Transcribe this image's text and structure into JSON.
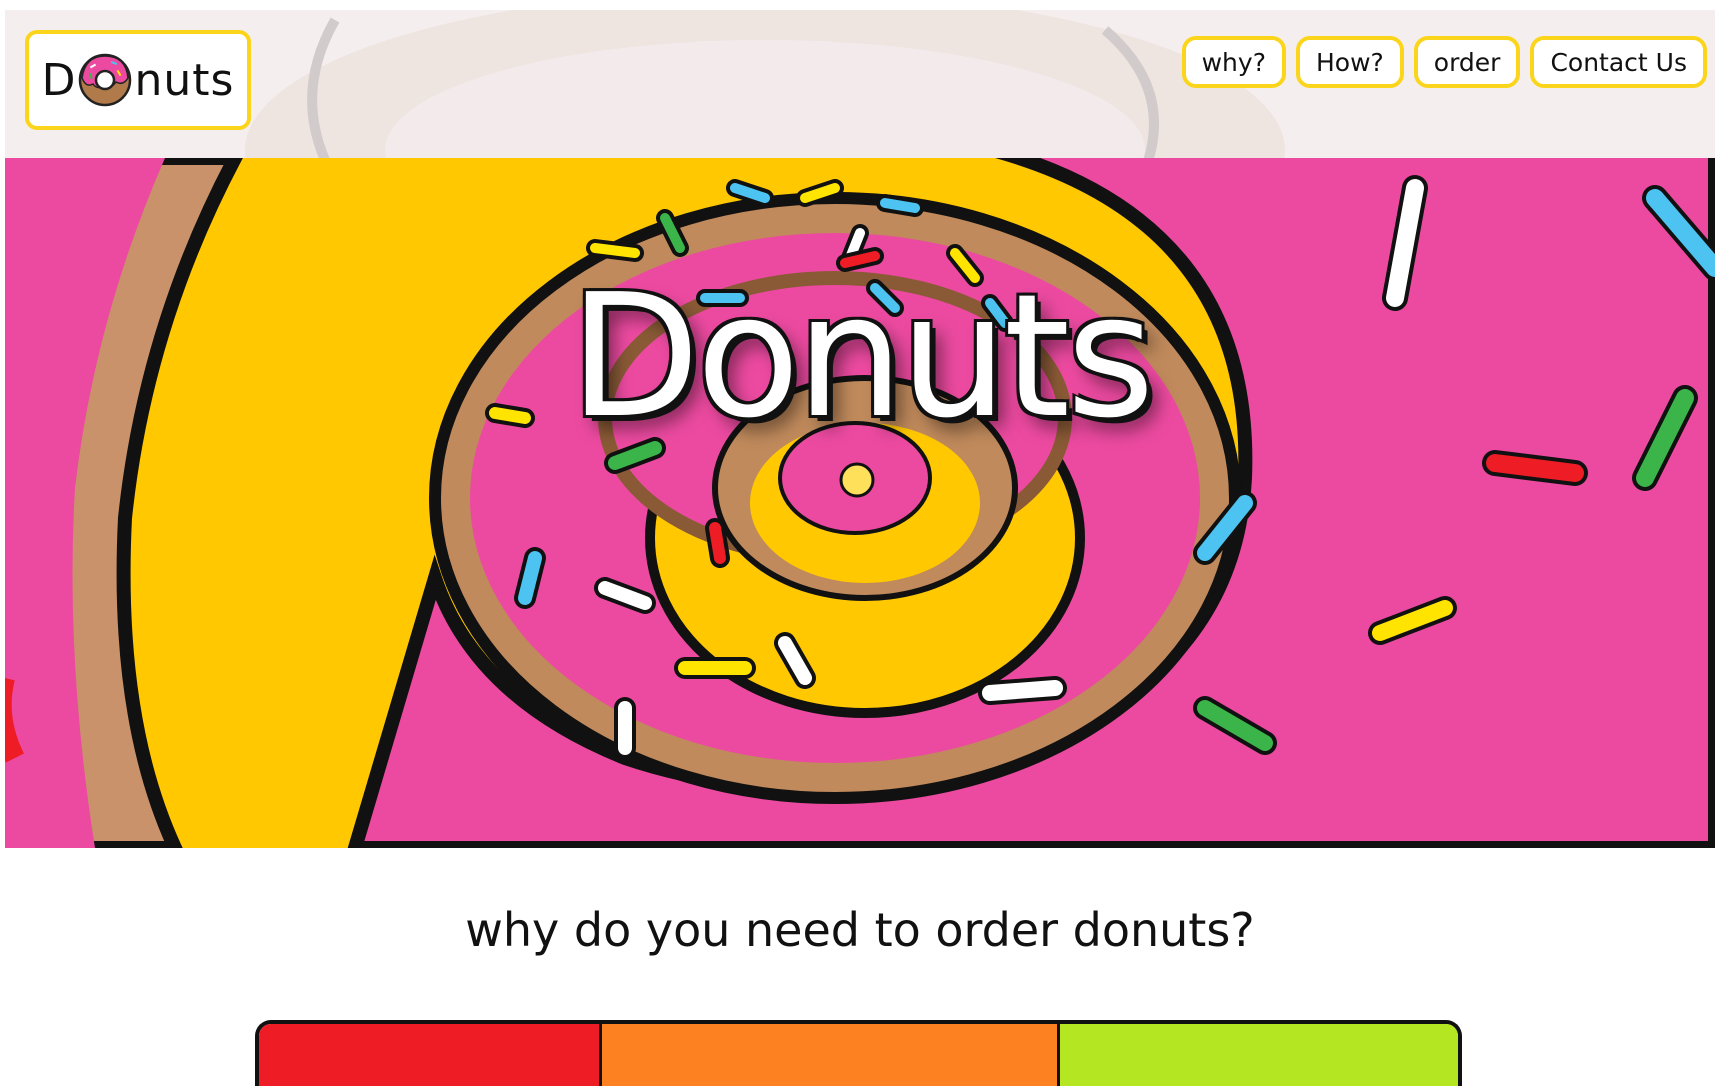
{
  "header": {
    "logo_prefix": "D",
    "logo_suffix": "nuts",
    "nav": [
      "why?",
      "How?",
      "order",
      "Contact Us"
    ]
  },
  "hero": {
    "title": "Donuts"
  },
  "section": {
    "question": "why do you need to order donuts?"
  },
  "colors": {
    "accent_border": "#fad51b",
    "bar_1": "#ee1c25",
    "bar_2": "#fd8121",
    "bar_3": "#b5e622",
    "hero_yellow": "#ffc800",
    "frosting_pink": "#ec4aa0"
  },
  "icons": [
    "donut-logo-icon"
  ]
}
